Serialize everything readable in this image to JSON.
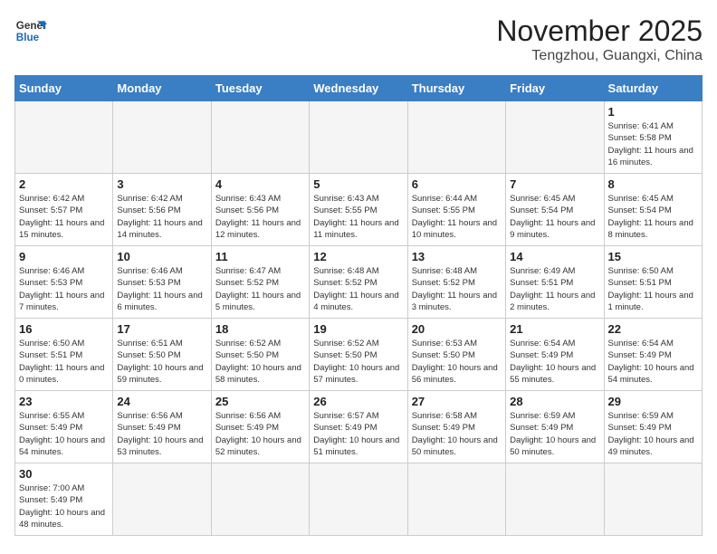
{
  "logo": {
    "line1": "General",
    "line2": "Blue"
  },
  "title": "November 2025",
  "location": "Tengzhou, Guangxi, China",
  "weekdays": [
    "Sunday",
    "Monday",
    "Tuesday",
    "Wednesday",
    "Thursday",
    "Friday",
    "Saturday"
  ],
  "days": [
    {
      "num": "",
      "info": ""
    },
    {
      "num": "",
      "info": ""
    },
    {
      "num": "",
      "info": ""
    },
    {
      "num": "",
      "info": ""
    },
    {
      "num": "",
      "info": ""
    },
    {
      "num": "",
      "info": ""
    },
    {
      "num": "1",
      "info": "Sunrise: 6:41 AM\nSunset: 5:58 PM\nDaylight: 11 hours\nand 16 minutes."
    },
    {
      "num": "2",
      "info": "Sunrise: 6:42 AM\nSunset: 5:57 PM\nDaylight: 11 hours\nand 15 minutes."
    },
    {
      "num": "3",
      "info": "Sunrise: 6:42 AM\nSunset: 5:56 PM\nDaylight: 11 hours\nand 14 minutes."
    },
    {
      "num": "4",
      "info": "Sunrise: 6:43 AM\nSunset: 5:56 PM\nDaylight: 11 hours\nand 12 minutes."
    },
    {
      "num": "5",
      "info": "Sunrise: 6:43 AM\nSunset: 5:55 PM\nDaylight: 11 hours\nand 11 minutes."
    },
    {
      "num": "6",
      "info": "Sunrise: 6:44 AM\nSunset: 5:55 PM\nDaylight: 11 hours\nand 10 minutes."
    },
    {
      "num": "7",
      "info": "Sunrise: 6:45 AM\nSunset: 5:54 PM\nDaylight: 11 hours\nand 9 minutes."
    },
    {
      "num": "8",
      "info": "Sunrise: 6:45 AM\nSunset: 5:54 PM\nDaylight: 11 hours\nand 8 minutes."
    },
    {
      "num": "9",
      "info": "Sunrise: 6:46 AM\nSunset: 5:53 PM\nDaylight: 11 hours\nand 7 minutes."
    },
    {
      "num": "10",
      "info": "Sunrise: 6:46 AM\nSunset: 5:53 PM\nDaylight: 11 hours\nand 6 minutes."
    },
    {
      "num": "11",
      "info": "Sunrise: 6:47 AM\nSunset: 5:52 PM\nDaylight: 11 hours\nand 5 minutes."
    },
    {
      "num": "12",
      "info": "Sunrise: 6:48 AM\nSunset: 5:52 PM\nDaylight: 11 hours\nand 4 minutes."
    },
    {
      "num": "13",
      "info": "Sunrise: 6:48 AM\nSunset: 5:52 PM\nDaylight: 11 hours\nand 3 minutes."
    },
    {
      "num": "14",
      "info": "Sunrise: 6:49 AM\nSunset: 5:51 PM\nDaylight: 11 hours\nand 2 minutes."
    },
    {
      "num": "15",
      "info": "Sunrise: 6:50 AM\nSunset: 5:51 PM\nDaylight: 11 hours\nand 1 minute."
    },
    {
      "num": "16",
      "info": "Sunrise: 6:50 AM\nSunset: 5:51 PM\nDaylight: 11 hours\nand 0 minutes."
    },
    {
      "num": "17",
      "info": "Sunrise: 6:51 AM\nSunset: 5:50 PM\nDaylight: 10 hours\nand 59 minutes."
    },
    {
      "num": "18",
      "info": "Sunrise: 6:52 AM\nSunset: 5:50 PM\nDaylight: 10 hours\nand 58 minutes."
    },
    {
      "num": "19",
      "info": "Sunrise: 6:52 AM\nSunset: 5:50 PM\nDaylight: 10 hours\nand 57 minutes."
    },
    {
      "num": "20",
      "info": "Sunrise: 6:53 AM\nSunset: 5:50 PM\nDaylight: 10 hours\nand 56 minutes."
    },
    {
      "num": "21",
      "info": "Sunrise: 6:54 AM\nSunset: 5:49 PM\nDaylight: 10 hours\nand 55 minutes."
    },
    {
      "num": "22",
      "info": "Sunrise: 6:54 AM\nSunset: 5:49 PM\nDaylight: 10 hours\nand 54 minutes."
    },
    {
      "num": "23",
      "info": "Sunrise: 6:55 AM\nSunset: 5:49 PM\nDaylight: 10 hours\nand 54 minutes."
    },
    {
      "num": "24",
      "info": "Sunrise: 6:56 AM\nSunset: 5:49 PM\nDaylight: 10 hours\nand 53 minutes."
    },
    {
      "num": "25",
      "info": "Sunrise: 6:56 AM\nSunset: 5:49 PM\nDaylight: 10 hours\nand 52 minutes."
    },
    {
      "num": "26",
      "info": "Sunrise: 6:57 AM\nSunset: 5:49 PM\nDaylight: 10 hours\nand 51 minutes."
    },
    {
      "num": "27",
      "info": "Sunrise: 6:58 AM\nSunset: 5:49 PM\nDaylight: 10 hours\nand 50 minutes."
    },
    {
      "num": "28",
      "info": "Sunrise: 6:59 AM\nSunset: 5:49 PM\nDaylight: 10 hours\nand 50 minutes."
    },
    {
      "num": "29",
      "info": "Sunrise: 6:59 AM\nSunset: 5:49 PM\nDaylight: 10 hours\nand 49 minutes."
    },
    {
      "num": "30",
      "info": "Sunrise: 7:00 AM\nSunset: 5:49 PM\nDaylight: 10 hours\nand 48 minutes."
    },
    {
      "num": "",
      "info": ""
    },
    {
      "num": "",
      "info": ""
    },
    {
      "num": "",
      "info": ""
    },
    {
      "num": "",
      "info": ""
    },
    {
      "num": "",
      "info": ""
    },
    {
      "num": "",
      "info": ""
    }
  ]
}
